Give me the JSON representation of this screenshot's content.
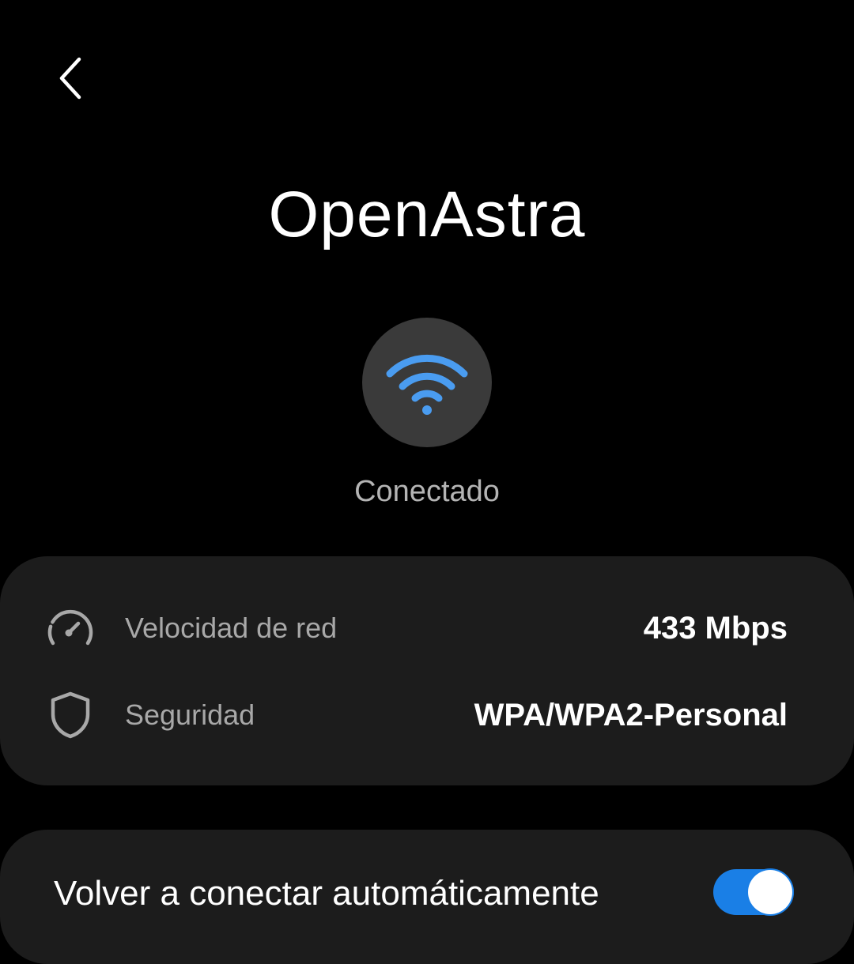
{
  "header": {
    "back_icon": "chevron-left-icon"
  },
  "network": {
    "name": "OpenAstra",
    "status": "Conectado",
    "status_icon": "wifi-icon",
    "accent_color": "#4a9cf0"
  },
  "details": {
    "rows": [
      {
        "icon": "speedometer-icon",
        "label": "Velocidad de red",
        "value": "433 Mbps"
      },
      {
        "icon": "shield-icon",
        "label": "Seguridad",
        "value": "WPA/WPA2-Personal"
      }
    ]
  },
  "auto_reconnect": {
    "label": "Volver a conectar automáticamente",
    "enabled": true,
    "toggle_color": "#1a7fe6"
  }
}
